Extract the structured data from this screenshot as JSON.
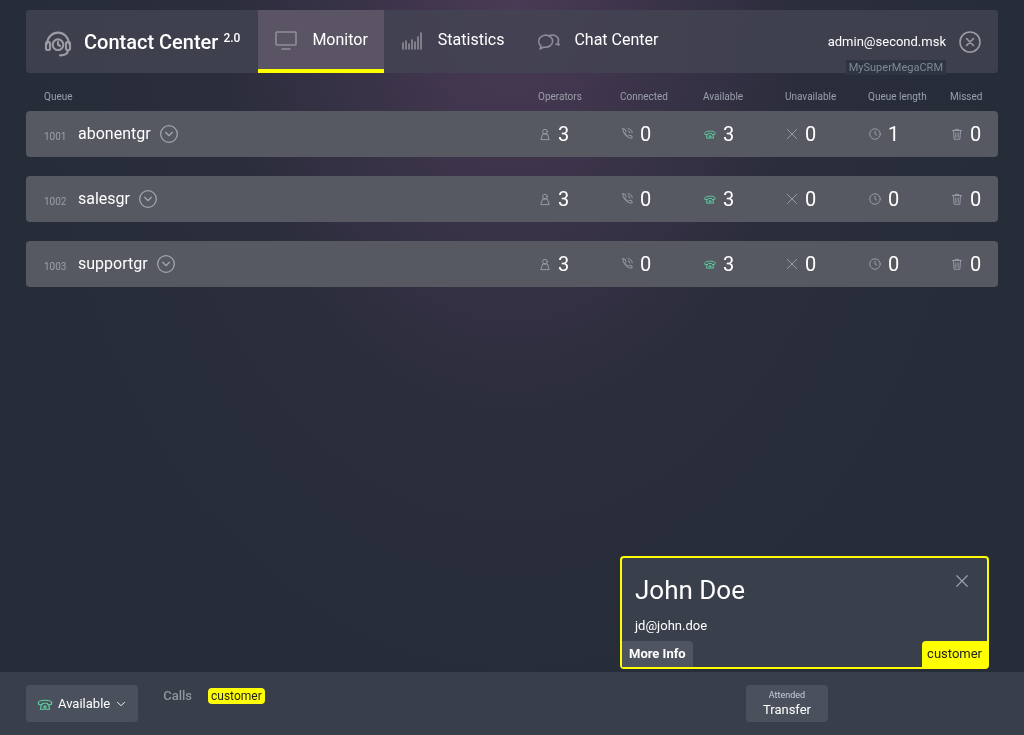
{
  "header": {
    "app_title": "Contact Center",
    "version": "2.0",
    "tabs": [
      {
        "label": "Monitor",
        "selected": true
      },
      {
        "label": "Statistics",
        "selected": false
      },
      {
        "label": "Chat Center",
        "selected": false
      }
    ],
    "user": "admin@second.msk",
    "crm_label": "MySuperMegaCRM"
  },
  "table": {
    "columns": [
      "Queue",
      "Operators",
      "Connected",
      "Available",
      "Unavailable",
      "Queue length",
      "Missed"
    ],
    "rows": [
      {
        "number": "1001",
        "name": "abonentgr",
        "values": [
          "3",
          "0",
          "3",
          "0",
          "1",
          "0"
        ]
      },
      {
        "number": "1002",
        "name": "salesgr",
        "values": [
          "3",
          "0",
          "3",
          "0",
          "0",
          "0"
        ]
      },
      {
        "number": "1003",
        "name": "supportgr",
        "values": [
          "3",
          "0",
          "3",
          "0",
          "0",
          "0"
        ]
      }
    ]
  },
  "contact_card": {
    "name": "John Doe",
    "email": "jd@john.doe",
    "more_info": "More Info",
    "tag": "customer"
  },
  "footer": {
    "status": "Available",
    "calls_label": "Calls",
    "call_tags": [
      "customer"
    ],
    "transfer_button": {
      "caption": "Attended",
      "label": "Transfer"
    }
  }
}
